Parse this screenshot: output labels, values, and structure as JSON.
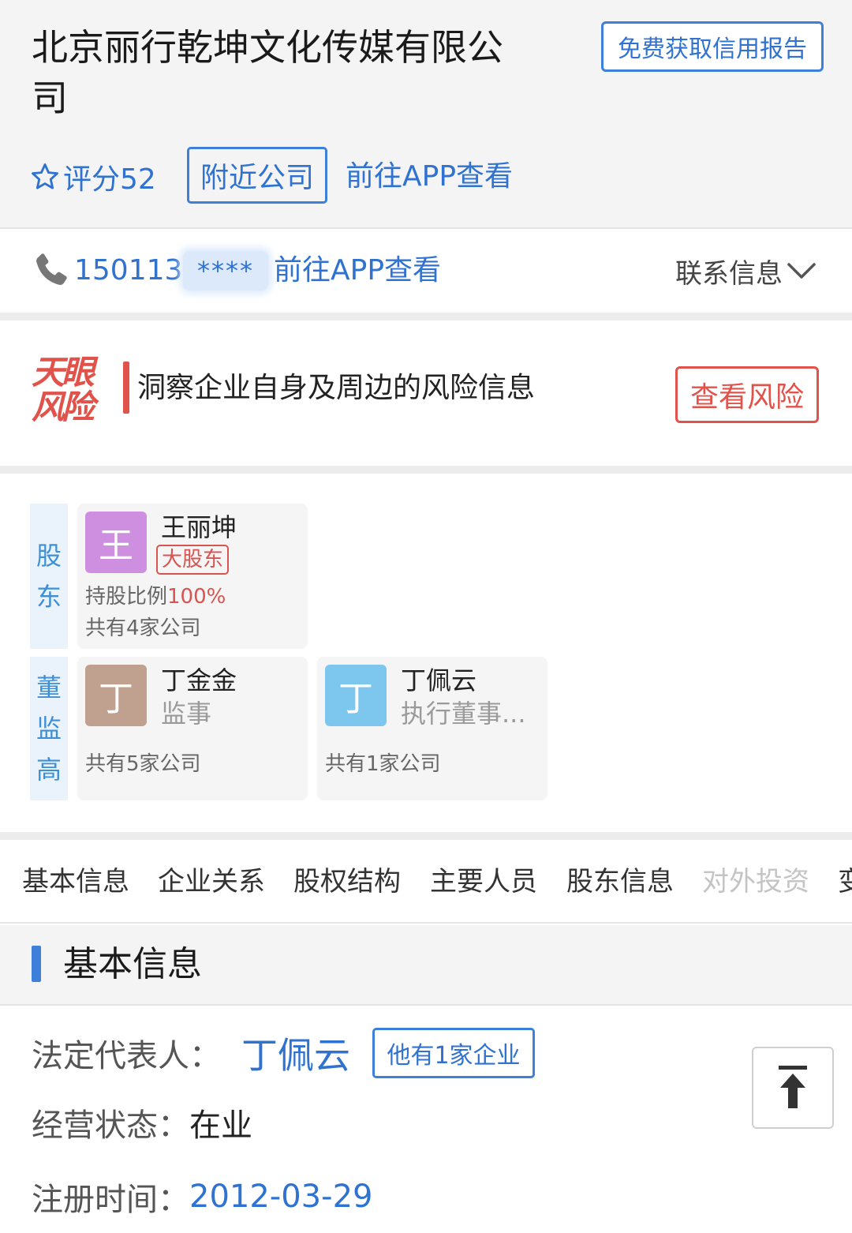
{
  "header": {
    "company_name": "北京丽行乾坤文化传媒有限公司",
    "report_button": "免费获取信用报告",
    "score_label": "评分52",
    "nearby_button": "附近公司",
    "app_link": "前往APP查看"
  },
  "contact": {
    "phone": "1501136",
    "masked": "****",
    "app_link": "前往APP查看",
    "toggle_label": "联系信息"
  },
  "risk": {
    "logo_line1": "天眼",
    "logo_line2": "风险",
    "description": "洞察企业自身及周边的风险信息",
    "button": "查看风险"
  },
  "people": {
    "shareholder_label": [
      "股",
      "东"
    ],
    "executive_label": [
      "董",
      "监",
      "高"
    ],
    "shareholders": [
      {
        "avatar_char": "王",
        "avatar_color": "#cf8fe0",
        "name": "王丽坤",
        "badge": "大股东",
        "ratio_label": "持股比例",
        "ratio_value": "100%",
        "companies": "共有4家公司"
      }
    ],
    "executives": [
      {
        "avatar_char": "丁",
        "avatar_color": "#c0a08e",
        "name": "丁金金",
        "role": "监事",
        "companies": "共有5家公司"
      },
      {
        "avatar_char": "丁",
        "avatar_color": "#7dc7ee",
        "name": "丁佩云",
        "role": "执行董事...",
        "companies": "共有1家公司"
      }
    ]
  },
  "tabs": [
    "基本信息",
    "企业关系",
    "股权结构",
    "主要人员",
    "股东信息",
    "对外投资",
    "变"
  ],
  "section": {
    "title": "基本信息"
  },
  "info": {
    "legal_rep_label": "法定代表人：",
    "legal_rep_name": "丁佩云",
    "legal_rep_button": "他有1家企业",
    "status_label": "经营状态：",
    "status_value": "在业",
    "reg_time_label": "注册时间：",
    "reg_time_value": "2012-03-29"
  },
  "colors": {
    "link_blue": "#2f72d0",
    "risk_red": "#e0524a",
    "section_accent": "#3d7fd9"
  },
  "icons": {
    "score": "star-icon",
    "phone": "phone-icon",
    "toggle": "chevron-down-icon",
    "scroll_top": "arrow-to-top-icon"
  }
}
